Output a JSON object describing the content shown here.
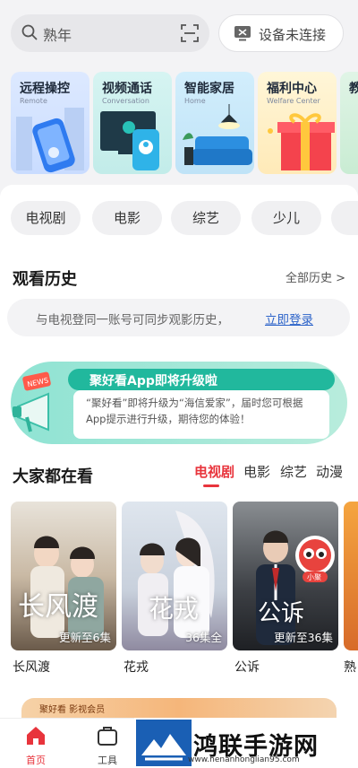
{
  "search": {
    "query": "熟年"
  },
  "device": {
    "label": "设备未连接"
  },
  "feature_cards": [
    {
      "title": "远程操控",
      "subtitle": "Remote"
    },
    {
      "title": "视频通话",
      "subtitle": "Conversation"
    },
    {
      "title": "智能家居",
      "subtitle": "Home"
    },
    {
      "title": "福利中心",
      "subtitle": "Welfare Center"
    },
    {
      "title": "教",
      "subtitle": ""
    }
  ],
  "categories": [
    "电视剧",
    "电影",
    "综艺",
    "少儿",
    "动"
  ],
  "history": {
    "title": "观看历史",
    "more": "全部历史 >",
    "hint": "与电视登同一账号可同步观影历史，",
    "login": "立即登录"
  },
  "banner": {
    "badge": "NEWS",
    "title": "聚好看App即将升级啦",
    "line1": "“聚好看”即将升级为“海信爱家”，届时您可根据",
    "line2": "App提示进行升级，期待您的体验！"
  },
  "popular": {
    "title": "大家都在看",
    "tabs": [
      "电视剧",
      "电影",
      "综艺",
      "动漫"
    ],
    "active_tab": "电视剧",
    "items": [
      {
        "title": "长风渡",
        "badge": "更新至6集",
        "poster_text": "长风渡"
      },
      {
        "title": "花戎",
        "badge": "36集全",
        "poster_text": "花戎"
      },
      {
        "title": "公诉",
        "badge": "更新至36集",
        "poster_text": "公诉",
        "mascot": "小聚"
      },
      {
        "title": "熟",
        "badge": "",
        "poster_text": ""
      }
    ]
  },
  "promo": {
    "text": "聚好看 影视会员"
  },
  "nav": {
    "items": [
      {
        "label": "首页",
        "icon": "home-icon"
      },
      {
        "label": "工具",
        "icon": "toolbox-icon"
      }
    ]
  },
  "watermark": {
    "title": "鸿联手游网",
    "url": "www.henanhonglian95.com"
  },
  "colors": {
    "accent": "#e8343c",
    "link": "#2c63c9",
    "teal": "#21b89d"
  }
}
